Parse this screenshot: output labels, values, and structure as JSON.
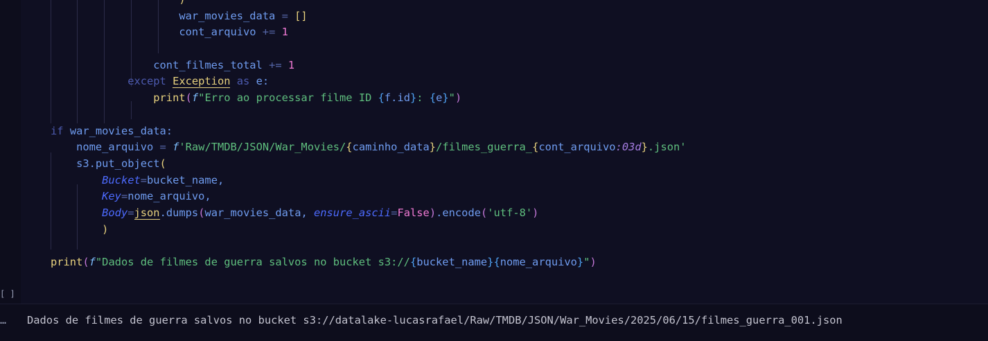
{
  "cell": {
    "prompt_label": "[ ]",
    "lines": [
      {
        "indent": 5,
        "tokens": [
          {
            "c": "br1",
            "t": ")"
          }
        ]
      },
      {
        "indent": 5,
        "tokens": [
          {
            "c": "kw",
            "t": "war_movies_data "
          },
          {
            "c": "op",
            "t": "= "
          },
          {
            "c": "br1",
            "t": "[]"
          }
        ]
      },
      {
        "indent": 5,
        "tokens": [
          {
            "c": "kw",
            "t": "cont_arquivo "
          },
          {
            "c": "op",
            "t": "+= "
          },
          {
            "c": "num",
            "t": "1"
          }
        ]
      },
      {
        "indent": 0,
        "tokens": []
      },
      {
        "indent": 4,
        "tokens": [
          {
            "c": "kw",
            "t": "cont_filmes_total "
          },
          {
            "c": "op",
            "t": "+= "
          },
          {
            "c": "num",
            "t": "1"
          }
        ]
      },
      {
        "indent": 3,
        "tokens": [
          {
            "c": "kw2",
            "t": "except "
          },
          {
            "c": "cls",
            "t": "Exception"
          },
          {
            "c": "kw2",
            "t": " as "
          },
          {
            "c": "kw",
            "t": "e:"
          }
        ]
      },
      {
        "indent": 4,
        "tokens": [
          {
            "c": "fn",
            "t": "print"
          },
          {
            "c": "br2",
            "t": "("
          },
          {
            "c": "fpre",
            "t": "f"
          },
          {
            "c": "str",
            "t": "\"Erro ao processar filme ID "
          },
          {
            "c": "br3",
            "t": "{"
          },
          {
            "c": "kw",
            "t": "f.id"
          },
          {
            "c": "br3",
            "t": "}"
          },
          {
            "c": "str",
            "t": ": "
          },
          {
            "c": "br3",
            "t": "{"
          },
          {
            "c": "kw",
            "t": "e"
          },
          {
            "c": "br3",
            "t": "}"
          },
          {
            "c": "str",
            "t": "\""
          },
          {
            "c": "br2",
            "t": ")"
          }
        ]
      },
      {
        "indent": 0,
        "tokens": []
      },
      {
        "indent": 0,
        "tokens": [
          {
            "c": "kw2",
            "t": "if "
          },
          {
            "c": "kw",
            "t": "war_movies_data:"
          }
        ]
      },
      {
        "indent": 1,
        "tokens": [
          {
            "c": "kw",
            "t": "nome_arquivo "
          },
          {
            "c": "op",
            "t": "= "
          },
          {
            "c": "fpre",
            "t": "f"
          },
          {
            "c": "str",
            "t": "'Raw/TMDB/JSON/War_Movies/"
          },
          {
            "c": "br1",
            "t": "{"
          },
          {
            "c": "kw",
            "t": "caminho_data"
          },
          {
            "c": "br1",
            "t": "}"
          },
          {
            "c": "str",
            "t": "/filmes_guerra_"
          },
          {
            "c": "br1",
            "t": "{"
          },
          {
            "c": "kw",
            "t": "cont_arquivo"
          },
          {
            "c": "fmt",
            "t": ":03d"
          },
          {
            "c": "br1",
            "t": "}"
          },
          {
            "c": "str",
            "t": ".json'"
          }
        ]
      },
      {
        "indent": 1,
        "tokens": [
          {
            "c": "kw",
            "t": "s3.put_object"
          },
          {
            "c": "br1",
            "t": "("
          }
        ]
      },
      {
        "indent": 2,
        "tokens": [
          {
            "c": "param",
            "t": "Bucket"
          },
          {
            "c": "op",
            "t": "="
          },
          {
            "c": "kw",
            "t": "bucket_name,"
          }
        ]
      },
      {
        "indent": 2,
        "tokens": [
          {
            "c": "param",
            "t": "Key"
          },
          {
            "c": "op",
            "t": "="
          },
          {
            "c": "kw",
            "t": "nome_arquivo,"
          }
        ]
      },
      {
        "indent": 2,
        "tokens": [
          {
            "c": "param",
            "t": "Body"
          },
          {
            "c": "op",
            "t": "="
          },
          {
            "c": "cls",
            "t": "json"
          },
          {
            "c": "kw",
            "t": ".dumps"
          },
          {
            "c": "br2",
            "t": "("
          },
          {
            "c": "kw",
            "t": "war_movies_data, "
          },
          {
            "c": "param",
            "t": "ensure_ascii"
          },
          {
            "c": "op",
            "t": "="
          },
          {
            "c": "bool",
            "t": "False"
          },
          {
            "c": "br2",
            "t": ")"
          },
          {
            "c": "kw",
            "t": ".encode"
          },
          {
            "c": "br2",
            "t": "("
          },
          {
            "c": "str",
            "t": "'utf-8'"
          },
          {
            "c": "br2",
            "t": ")"
          }
        ]
      },
      {
        "indent": 2,
        "tokens": [
          {
            "c": "br1",
            "t": ")"
          }
        ]
      },
      {
        "indent": 0,
        "tokens": []
      },
      {
        "indent": 0,
        "tokens": [
          {
            "c": "fn",
            "t": "print"
          },
          {
            "c": "br2",
            "t": "("
          },
          {
            "c": "fpre",
            "t": "f"
          },
          {
            "c": "str",
            "t": "\"Dados de filmes de guerra salvos no bucket s3://"
          },
          {
            "c": "br3",
            "t": "{"
          },
          {
            "c": "kw",
            "t": "bucket_name"
          },
          {
            "c": "br3",
            "t": "}{"
          },
          {
            "c": "kw",
            "t": "nome_arquivo"
          },
          {
            "c": "br3",
            "t": "}"
          },
          {
            "c": "str",
            "t": "\""
          },
          {
            "c": "br2",
            "t": ")"
          }
        ]
      }
    ]
  },
  "output": {
    "prompt_label": "…",
    "text": "Dados de filmes de guerra salvos no bucket s3://datalake-lucasrafael/Raw/TMDB/JSON/War_Movies/2025/06/15/filmes_guerra_001.json"
  }
}
